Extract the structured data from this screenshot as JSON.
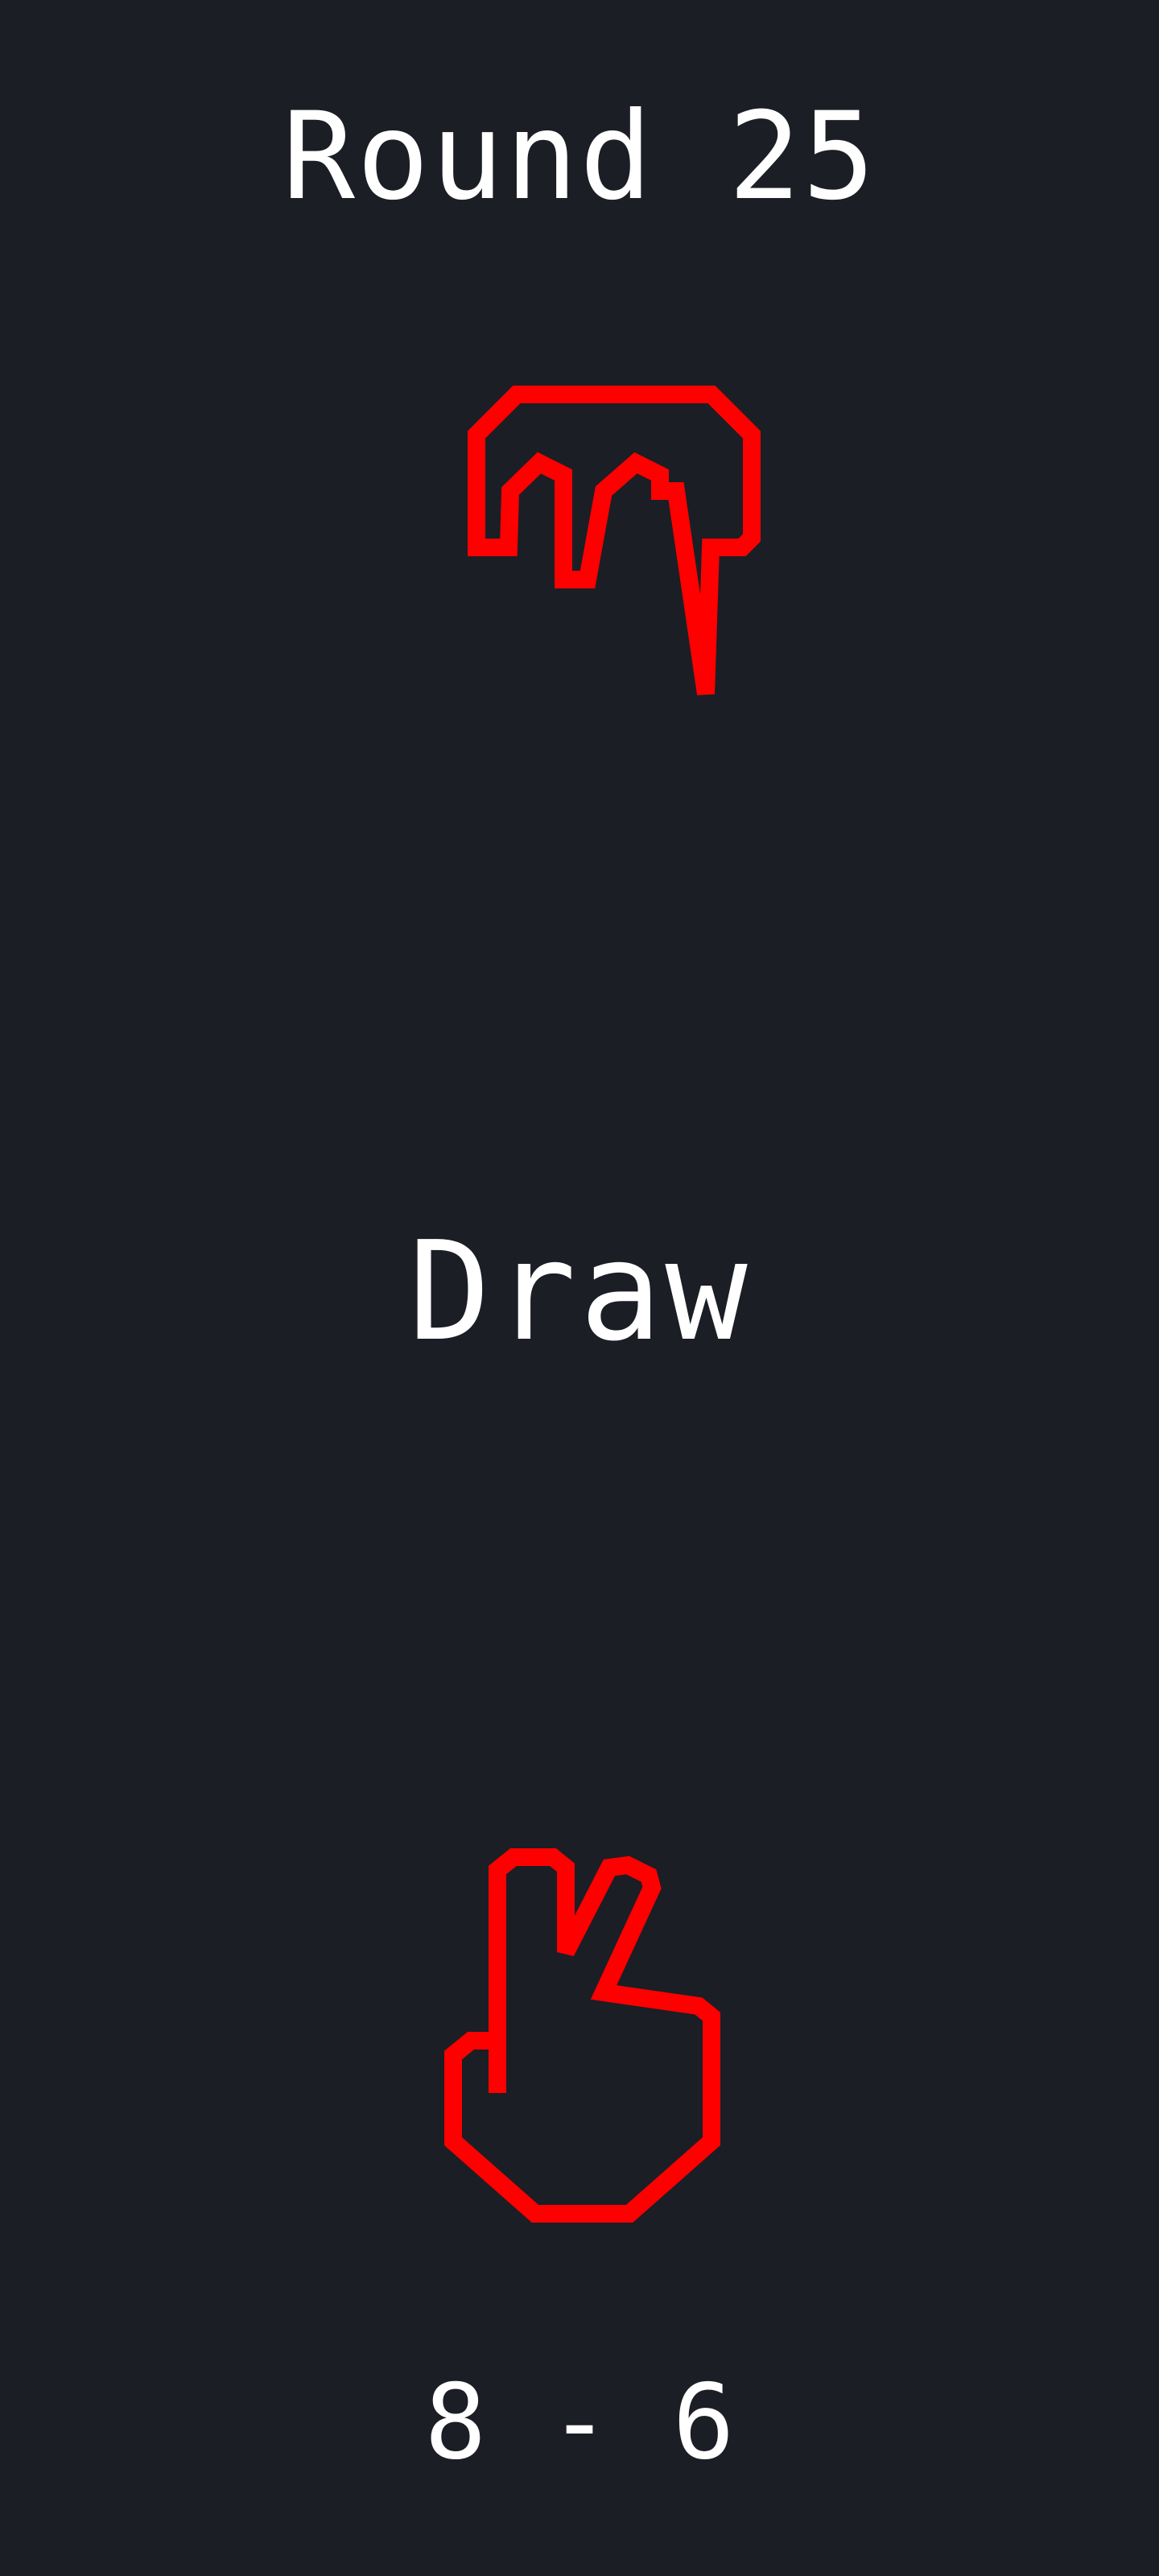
{
  "round": {
    "label": "Round 25"
  },
  "opponent": {
    "hand_icon": "scissors-hand-icon",
    "hand_color": "#ff0000"
  },
  "result": {
    "text": "Draw"
  },
  "player": {
    "hand_icon": "scissors-hand-icon",
    "hand_color": "#ff0000"
  },
  "score": {
    "text": "8 - 6"
  },
  "theme": {
    "background": "#1b1e25",
    "text": "#ffffff"
  }
}
